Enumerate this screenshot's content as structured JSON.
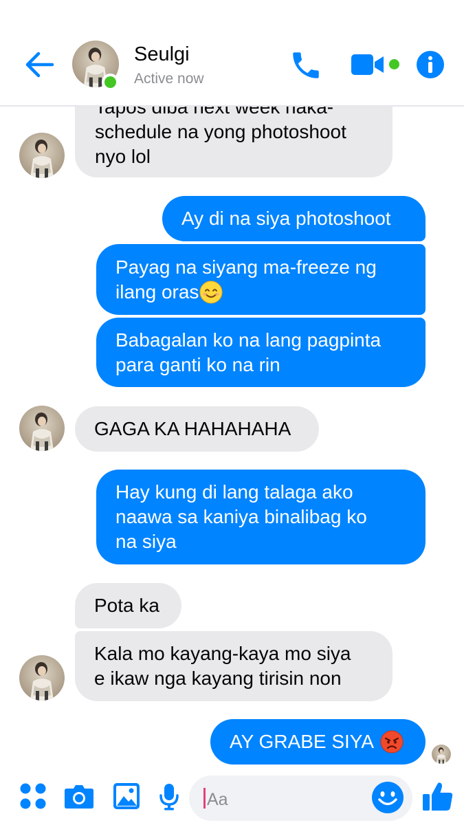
{
  "header": {
    "contact_name": "Seulgi",
    "status": "Active now",
    "icons": [
      "back-arrow-icon",
      "phone-icon",
      "video-camera-icon",
      "info-icon"
    ]
  },
  "messages": [
    {
      "side": "in",
      "lines": [
        "Tapos diba next week naka-",
        "schedule na yong photoshoot",
        "nyo lol"
      ]
    },
    {
      "side": "out",
      "lines": [
        "Ay di na siya photoshoot"
      ]
    },
    {
      "side": "out",
      "lines": [
        "Payag na siyang ma-freeze ng",
        "ilang oras"
      ],
      "emoji": "smiling-face-icon"
    },
    {
      "side": "out",
      "lines": [
        "Babagalan ko na lang pagpinta",
        "para ganti ko na rin"
      ]
    },
    {
      "side": "in",
      "lines": [
        "GAGA KA HAHAHAHA"
      ]
    },
    {
      "side": "out",
      "lines": [
        "Hay kung di lang talaga ako",
        "naawa sa kaniya binalibag ko",
        "na siya"
      ]
    },
    {
      "side": "in",
      "lines": [
        "Pota ka"
      ]
    },
    {
      "side": "in",
      "lines": [
        "Kala mo kayang-kaya mo siya",
        "e ikaw nga kayang tirisin non"
      ]
    },
    {
      "side": "out",
      "lines": [
        "AY GRABE SIYA"
      ],
      "emoji": "angry-face-icon"
    }
  ],
  "composer": {
    "placeholder": "Aa",
    "icons": [
      "apps-grid-icon",
      "camera-icon",
      "gallery-icon",
      "microphone-icon",
      "emoji-icon",
      "thumbs-up-icon"
    ]
  },
  "colors": {
    "accent": "#0084ff",
    "incoming_bubble": "#e9e9eb",
    "online": "#44c723"
  }
}
